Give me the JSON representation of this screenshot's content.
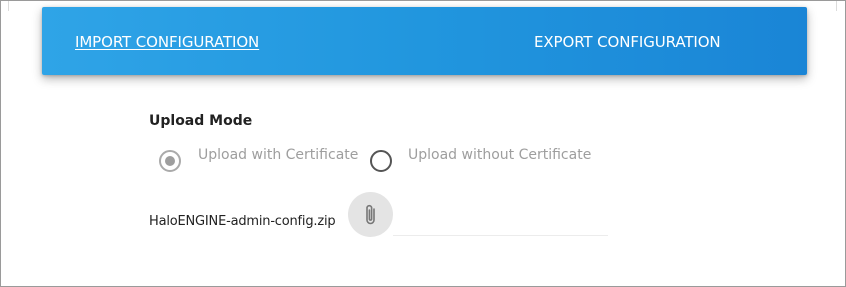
{
  "tabs": {
    "import_label": "IMPORT CONFIGURATION",
    "export_label": "EXPORT CONFIGURATION"
  },
  "upload_mode": {
    "title": "Upload Mode",
    "options": [
      {
        "label": "Upload with Certificate",
        "selected": true
      },
      {
        "label": "Upload without Certificate",
        "selected": false
      }
    ]
  },
  "file": {
    "name": "HaloENGINE-admin-config.zip",
    "attach_icon": "paperclip-icon"
  },
  "colors": {
    "tab_bar_start": "#2fa4e7",
    "tab_bar_end": "#1a85d6",
    "disabled_text": "#9e9e9e"
  }
}
